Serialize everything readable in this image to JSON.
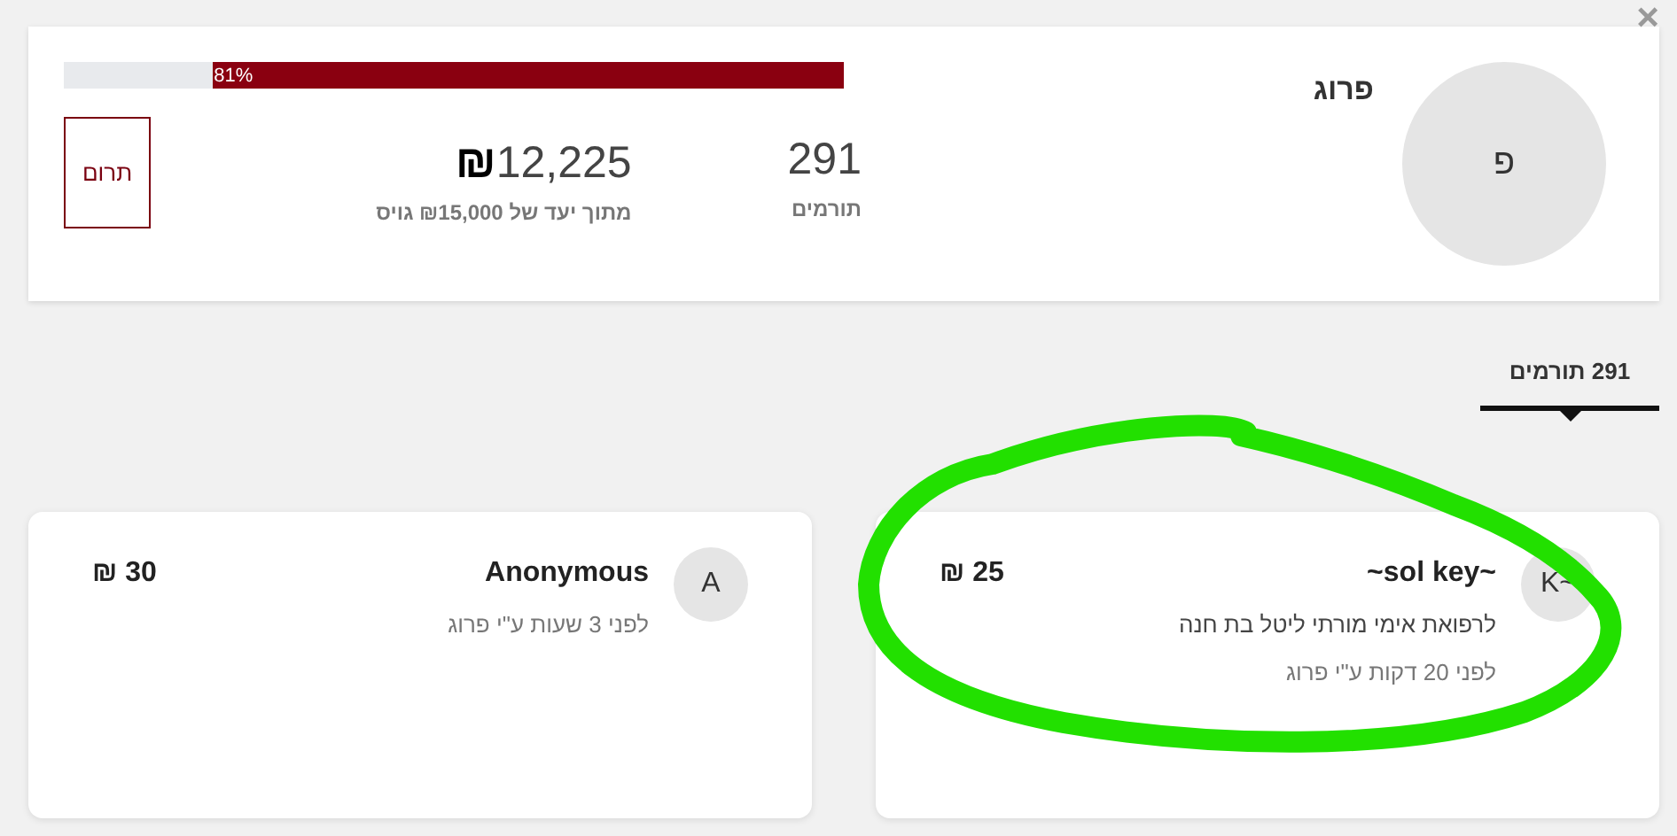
{
  "close_button": {
    "label": "×"
  },
  "campaign": {
    "avatar_letter": "פ",
    "name": "פרוג",
    "progress": {
      "level": 0.81,
      "label": "81%"
    },
    "donors": {
      "count": "291",
      "label": "תורמים"
    },
    "raised": {
      "currency": "₪",
      "value": "12,225",
      "goal_text": "מתוך יעד של ₪15,000 גויס"
    },
    "donate_button": "תרום"
  },
  "tabs": [
    {
      "label": "291 תורמים",
      "selected": true
    }
  ],
  "donations": [
    {
      "avatar_letter": "K~",
      "name": "~sol key~",
      "amount": "₪ 25",
      "message": "לרפואת אימי מורתי ליטל בת חנה",
      "time": "לפני 20 דקות ע\"י פרוג"
    },
    {
      "avatar_letter": "A",
      "name": "Anonymous",
      "amount": "₪ 30",
      "time": "לפני 3 שעות ע\"י פרוג"
    }
  ]
}
